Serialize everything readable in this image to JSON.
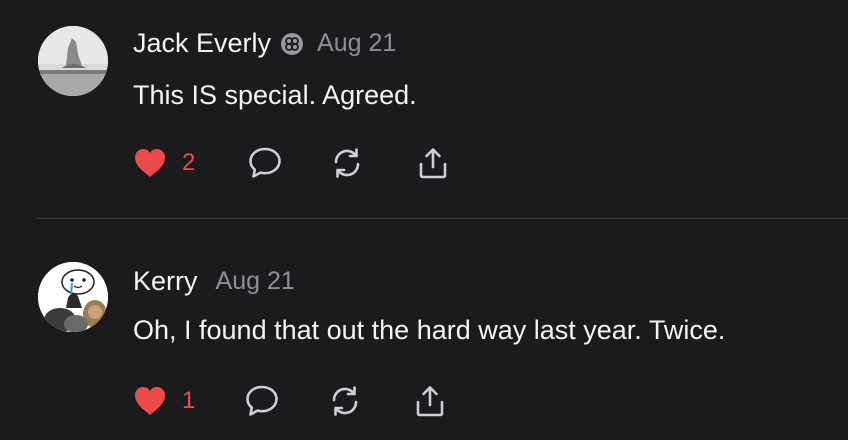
{
  "accent_like": "#ec4a4a",
  "posts": [
    {
      "author": "Jack Everly",
      "verified_badge": "badge-icon",
      "date": "Aug 21",
      "text": "This IS special. Agreed.",
      "likes": "2",
      "liked": true,
      "avatar": "photo-avatar"
    },
    {
      "author": "Kerry",
      "date": "Aug 21",
      "text": "Oh, I found that out the hard way last year. Twice.",
      "likes": "1",
      "liked": true,
      "avatar": "cartoon-cat-avatar"
    }
  ],
  "icons": {
    "like": "heart-icon",
    "reply": "comment-icon",
    "repost": "repost-icon",
    "share": "share-icon"
  }
}
